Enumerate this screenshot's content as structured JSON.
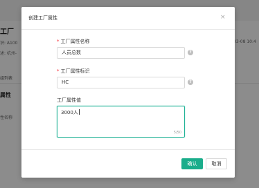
{
  "background": {
    "title": "工厂",
    "code_line": "识: A100",
    "addr_line": "述: 杭州-",
    "date_line": "03-08 10:4",
    "tab": "组列表",
    "section": "属性",
    "column": "性名称"
  },
  "modal": {
    "title": "创建工厂属性",
    "close_label": "×",
    "fields": [
      {
        "label": "工厂属性名称",
        "required": "*",
        "value": "人员总数"
      },
      {
        "label": "工厂属性标识",
        "required": "*",
        "value": "HC"
      },
      {
        "label": "工厂属性值",
        "value": "3000人",
        "counter": "5/50"
      }
    ],
    "help_icon_glyph": "?",
    "ok_label": "确认",
    "cancel_label": "取消"
  },
  "colors": {
    "accent": "#1aad8b",
    "required": "#f5222d",
    "overlay": "rgba(0,0,0,0.45)"
  }
}
